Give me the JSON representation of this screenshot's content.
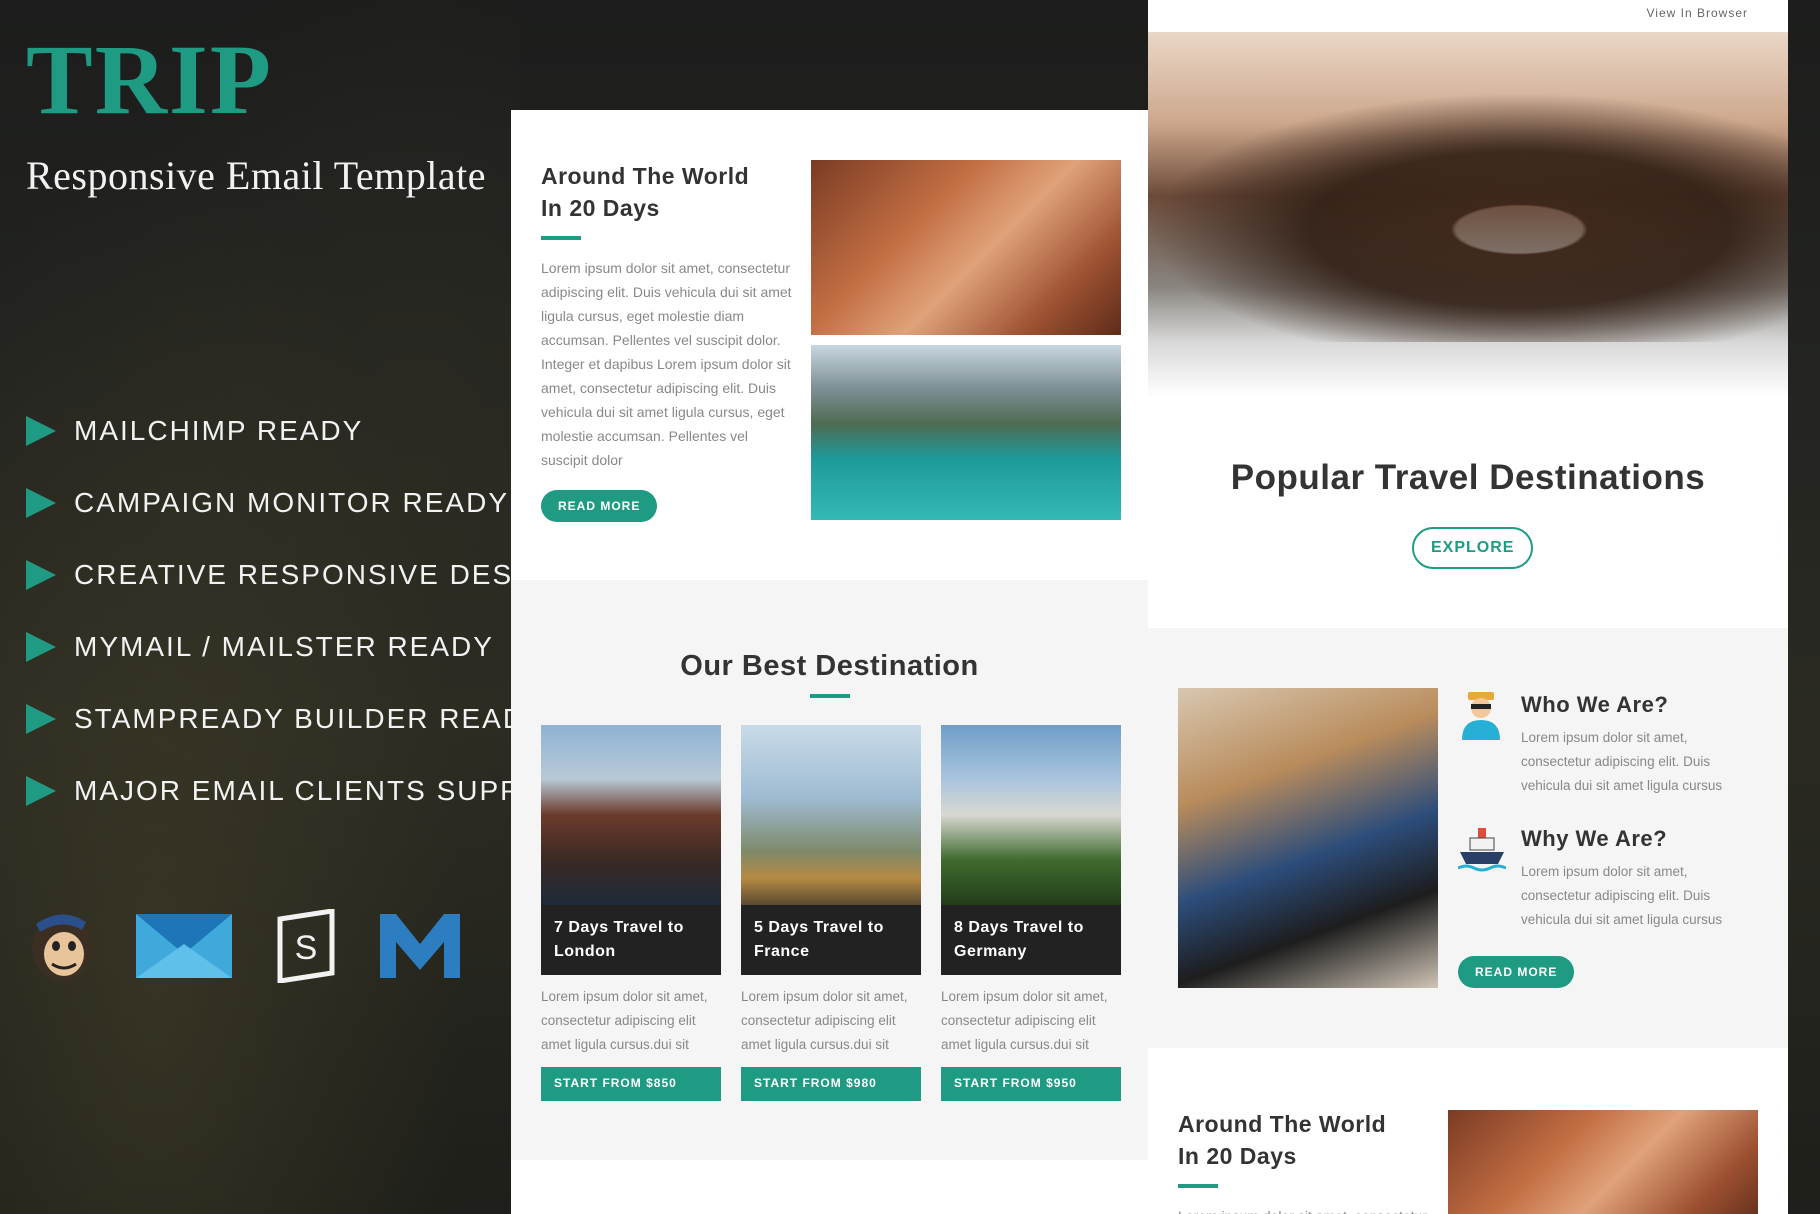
{
  "brand": {
    "title": "TRIP",
    "subtitle": "Responsive Email Template",
    "accent_color": "#1e9b82"
  },
  "features": [
    "MAILCHIMP READY",
    "CAMPAIGN MONITOR READY",
    "CREATIVE RESPONSIVE DESIGN",
    "MYMAIL / MAILSTER READY",
    "STAMPREADY BUILDER READY",
    "MAJOR EMAIL CLIENTS SUPPORT"
  ],
  "logos": [
    "mailchimp-logo",
    "campaign-monitor-logo",
    "stampready-logo",
    "mymail-logo"
  ],
  "middle_panel": {
    "around": {
      "title_line1": "Around The World",
      "title_line2": "In 20 Days",
      "text": "Lorem ipsum dolor sit amet, consectetur adipiscing elit. Duis vehicula dui sit amet ligula cursus, eget molestie diam accumsan. Pellentes vel suscipit dolor. Integer et dapibus Lorem ipsum dolor sit amet, consectetur adipiscing elit. Duis vehicula dui sit amet ligula cursus, eget molestie accumsan. Pellentes vel suscipit dolor",
      "button": "READ MORE"
    },
    "best": {
      "title": "Our Best Destination",
      "destinations": [
        {
          "caption_line1": "7 Days Travel to",
          "caption_line2": "London",
          "text": "Lorem ipsum dolor sit amet, consectetur adipiscing elit amet ligula cursus.dui sit",
          "button": "START FROM $850"
        },
        {
          "caption_line1": "5 Days Travel to",
          "caption_line2": "France",
          "text": "Lorem ipsum dolor sit amet, consectetur adipiscing elit amet ligula cursus.dui sit",
          "button": "START FROM $980"
        },
        {
          "caption_line1": "8 Days Travel to",
          "caption_line2": "Germany",
          "text": "Lorem ipsum dolor sit amet, consectetur adipiscing elit amet ligula cursus.dui sit",
          "button": "START FROM $950"
        }
      ]
    }
  },
  "right_panel": {
    "view_in_browser": "View In Browser",
    "hero_title": "Popular Travel Destinations",
    "explore_button": "EXPLORE",
    "about": [
      {
        "title": "Who We Are?",
        "text": "Lorem ipsum dolor sit amet, consectetur adipiscing elit. Duis vehicula dui sit amet ligula cursus",
        "icon": "traveler-icon"
      },
      {
        "title": "Why We Are?",
        "text": "Lorem ipsum dolor sit amet, consectetur adipiscing elit. Duis vehicula dui sit amet ligula cursus",
        "icon": "cruise-ship-icon"
      }
    ],
    "about_button": "READ MORE",
    "around": {
      "title_line1": "Around The World",
      "title_line2": "In 20 Days",
      "text_preview": "Lorem ipsum dolor sit amet, consectetur"
    }
  }
}
